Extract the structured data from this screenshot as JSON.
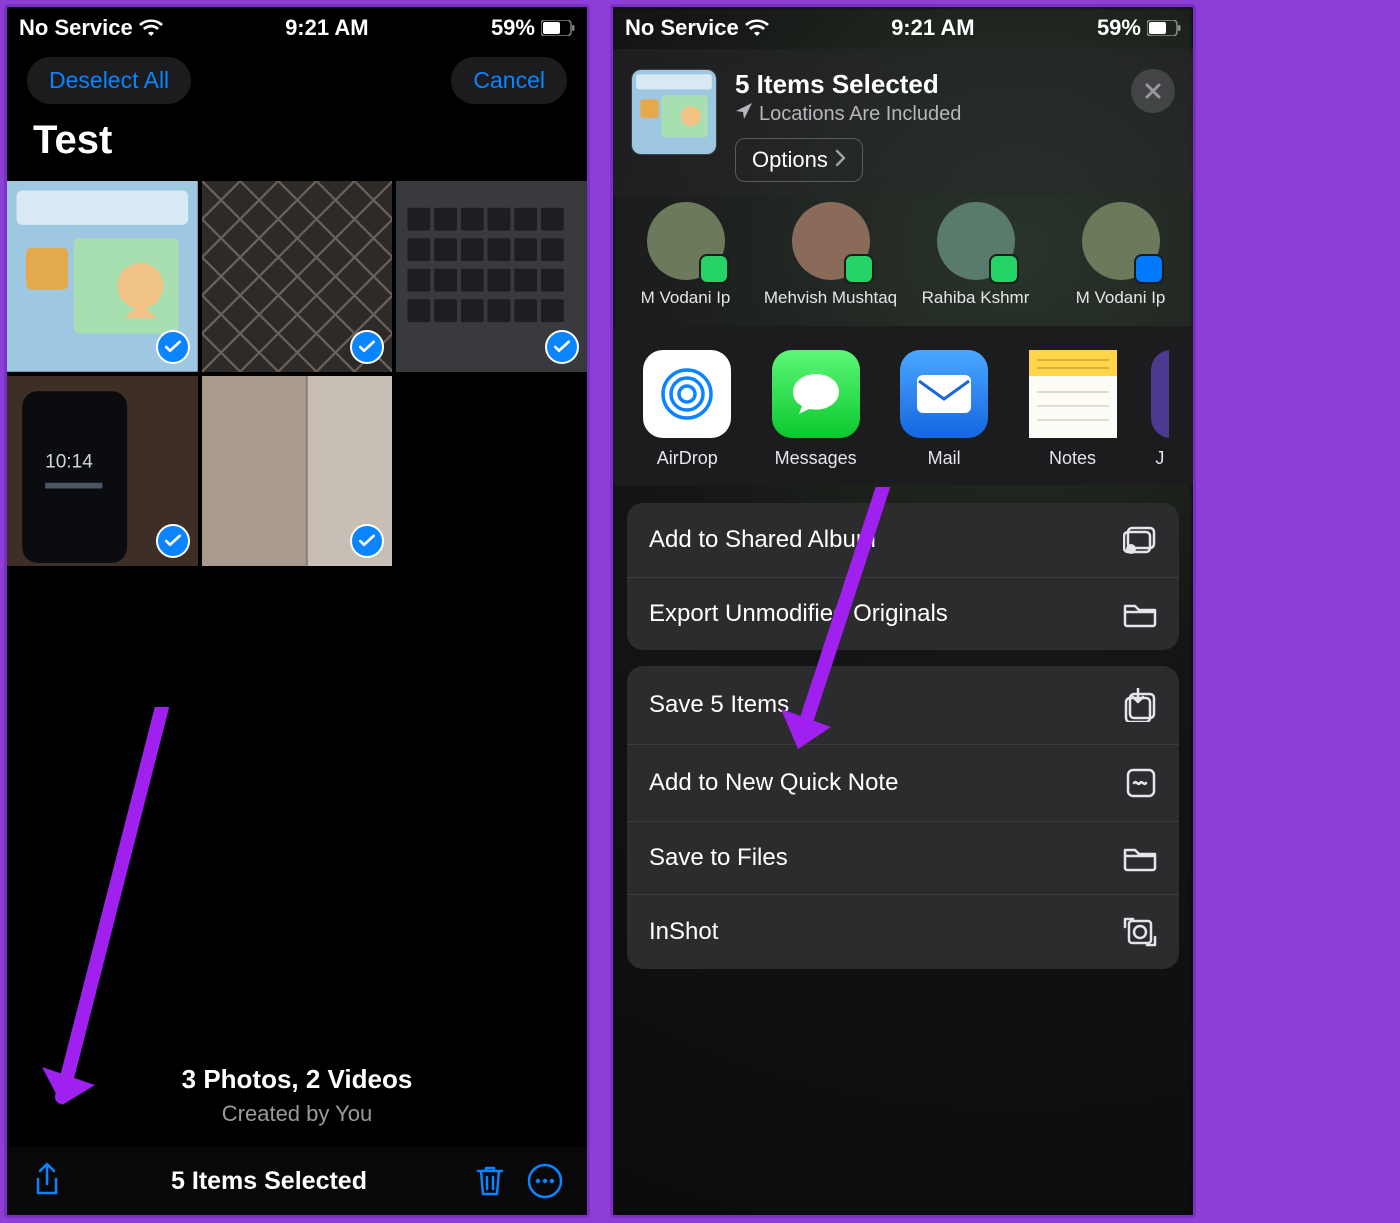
{
  "left": {
    "status": {
      "carrier": "No Service",
      "time": "9:21 AM",
      "battery": "59%"
    },
    "topbar": {
      "deselect": "Deselect All",
      "cancel": "Cancel"
    },
    "album_title": "Test",
    "summary": {
      "line1": "3 Photos, 2 Videos",
      "line2": "Created by You"
    },
    "bottom": {
      "status_text": "5 Items Selected"
    }
  },
  "right": {
    "status": {
      "carrier": "No Service",
      "time": "9:21 AM",
      "battery": "59%"
    },
    "share_header": {
      "title": "5 Items Selected",
      "subtitle": "Locations Are Included",
      "options": "Options"
    },
    "contacts": [
      {
        "name": "M Vodani Ip"
      },
      {
        "name": "Mehvish Mushtaq"
      },
      {
        "name": "Rahiba Kshmr"
      },
      {
        "name": "M Vodani Ip"
      }
    ],
    "apps": [
      {
        "name": "AirDrop"
      },
      {
        "name": "Messages"
      },
      {
        "name": "Mail"
      },
      {
        "name": "Notes"
      },
      {
        "name": "J"
      }
    ],
    "actions_group1": [
      {
        "label": "Add to Shared Album"
      },
      {
        "label": "Export Unmodified Originals"
      }
    ],
    "actions_group2": [
      {
        "label": "Save 5 Items"
      },
      {
        "label": "Add to New Quick Note"
      },
      {
        "label": "Save to Files"
      },
      {
        "label": "InShot"
      }
    ]
  }
}
